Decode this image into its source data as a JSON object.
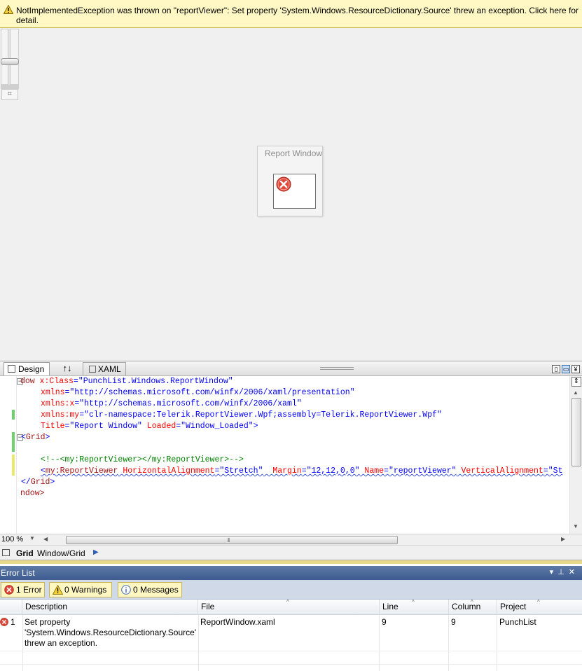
{
  "infobar": {
    "message": "NotImplementedException was thrown on \"reportViewer\": Set property 'System.Windows.ResourceDictionary.Source' threw an exception. Click here for detail."
  },
  "designer": {
    "window_title": "Report Window"
  },
  "tabs": {
    "design": "Design",
    "swap": "↑↓",
    "xaml": "XAML"
  },
  "xaml": {
    "l1a": "dow ",
    "l1b": "x:Class",
    "l1c": "=\"PunchList.Windows.ReportWindow\"",
    "l2a": "xmlns",
    "l2b": "=\"http://schemas.microsoft.com/winfx/2006/xaml/presentation\"",
    "l3a": "xmlns:x",
    "l3b": "=\"http://schemas.microsoft.com/winfx/2006/xaml\"",
    "l4a": "xmlns:my",
    "l4b": "=\"clr-namespace:Telerik.ReportViewer.Wpf;assembly=Telerik.ReportViewer.Wpf\"",
    "l5a": "Title",
    "l5b": "=\"Report Window\"",
    "l5c": " Loaded",
    "l5d": "=\"Window_Loaded\">",
    "l6a": "<",
    "l6b": "Grid",
    "l6c": ">",
    "l8": "<!--<my:ReportViewer></my:ReportViewer>-->",
    "l9a": "<",
    "l9b": "my:ReportViewer",
    "l9c": " HorizontalAlignment",
    "l9d": "=\"Stretch\"",
    "l9e": "  Margin",
    "l9f": "=\"12,12,0,0\"",
    "l9g": " Name",
    "l9h": "=\"reportViewer\"",
    "l9i": " VerticalAlignment",
    "l9j": "=\"St",
    "l10a": "</",
    "l10b": "Grid",
    "l10c": ">",
    "l11": "ndow>"
  },
  "editor": {
    "zoom": "100 %"
  },
  "breadcrumb": {
    "bold": "Grid",
    "path": "Window/Grid"
  },
  "error_list": {
    "title": "Error List",
    "filters": {
      "errors": "1 Error",
      "warnings": "0 Warnings",
      "messages": "0 Messages"
    },
    "columns": [
      "Description",
      "File",
      "Line",
      "Column",
      "Project"
    ],
    "rows": [
      {
        "num": "1",
        "description_l1": "Set property",
        "description_l2": "'System.Windows.ResourceDictionary.Source'",
        "description_l3": "threw an exception.",
        "file": "ReportWindow.xaml",
        "line": "9",
        "column": "9",
        "project": "PunchList"
      }
    ]
  }
}
